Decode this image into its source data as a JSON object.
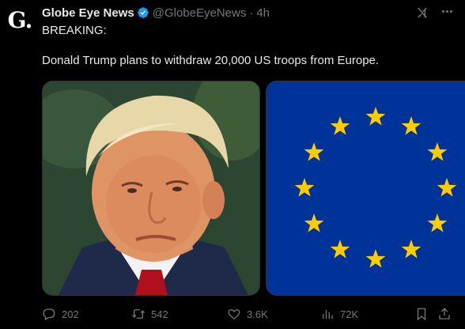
{
  "post": {
    "author_name": "Globe Eye News",
    "handle": "@GlobeEyeNews",
    "separator": "·",
    "time": "4h",
    "avatar_letter": "G.",
    "text_line1": "BREAKING:",
    "text_line2": "Donald Trump plans to withdraw 20,000 US troops from Europe."
  },
  "actions": {
    "replies": "202",
    "reposts": "542",
    "likes": "3.6K",
    "views": "72K"
  },
  "colors": {
    "background": "#000000",
    "text": "#e7e9ea",
    "muted": "#71767b",
    "verified_blue": "#1d9bf0",
    "eu_blue": "#003399",
    "eu_gold": "#ffcc00"
  }
}
